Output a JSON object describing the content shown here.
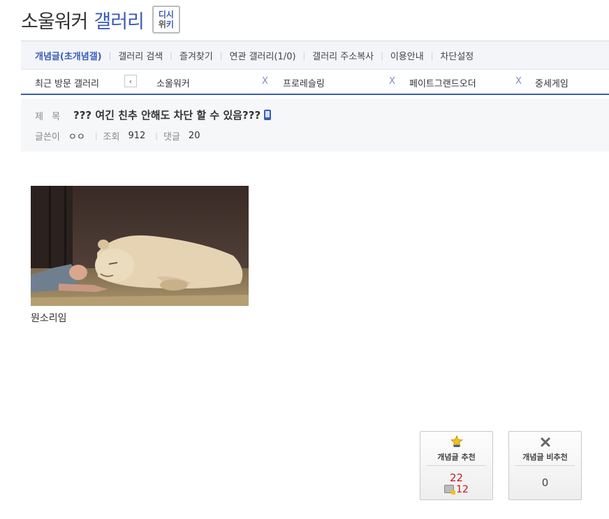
{
  "header": {
    "gallery_name": "소울워커",
    "gallery_suffix": "갤러리",
    "wiki_badge": {
      "line1": "디시",
      "line2_a": "위",
      "line2_b": "키"
    }
  },
  "menu": {
    "items": [
      "개념글(초개념갤)",
      "갤러리 검색",
      "즐겨찾기",
      "연관 갤러리(1/0)",
      "갤러리 주소복사",
      "이용안내",
      "차단설정"
    ]
  },
  "recent": {
    "label": "최근 방문 갤러리",
    "prev_icon": "‹",
    "close_icon": "X",
    "galleries": [
      "소울워커",
      "프로레슬링",
      "페이트그랜드오더",
      "중세게임"
    ]
  },
  "post": {
    "title_label": "제 목",
    "title": "??? 여긴 친추 안해도 차단 할 수 있음???",
    "title_icon": "mobile-icon",
    "author_label": "글쓴이",
    "author": "ㅇㅇ",
    "views_label": "조회",
    "views": "912",
    "comments_label": "댓글",
    "comments": "20"
  },
  "content": {
    "image_desc": "man sleeping beside a white lioness and cub",
    "caption": "뭔소리임"
  },
  "votes": {
    "recommend": {
      "label": "개념글 추천",
      "count": "22",
      "fixed_count": "12",
      "icon": "star-icon"
    },
    "not_recommend": {
      "label": "개념글 비추천",
      "count": "0",
      "icon": "x-icon"
    }
  },
  "colors": {
    "accent": "#3b5cb8",
    "vote_red": "#c0181f"
  }
}
